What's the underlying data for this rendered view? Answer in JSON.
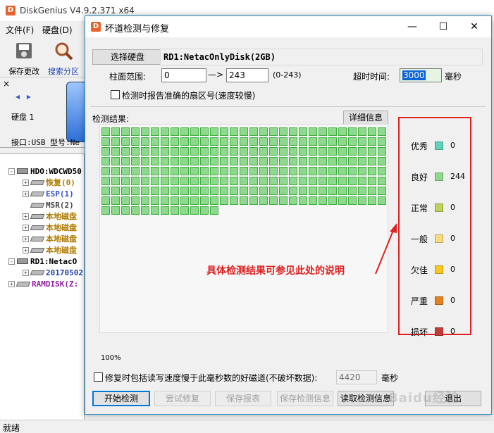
{
  "app": {
    "title": "DiskGenius V4.9.2.371 x64",
    "logo_letter": "D",
    "menu": [
      "文件(F)",
      "硬盘(D)"
    ],
    "toolbar": [
      {
        "label": "保存更改",
        "icon": "save-disk-icon"
      },
      {
        "label": "搜索分区",
        "icon": "magnifier-icon"
      }
    ],
    "disk_nav": "◂ ▸",
    "disk_label": "硬盘 1",
    "disk_interface": "接口:USB  型号:Ne",
    "tree": [
      {
        "label": "HDO:WDCWD50",
        "color": "#000000",
        "level": 0,
        "kind": "disk",
        "expander": "-"
      },
      {
        "label": "恢复(0)",
        "color": "#b07a00",
        "level": 1,
        "kind": "part",
        "expander": "+"
      },
      {
        "label": "ESP(1)",
        "color": "#3050d0",
        "level": 1,
        "kind": "part",
        "expander": "+"
      },
      {
        "label": "MSR(2)",
        "color": "#444444",
        "level": 1,
        "kind": "part",
        "expander": ""
      },
      {
        "label": "本地磁盘",
        "color": "#b07a00",
        "level": 1,
        "kind": "part",
        "expander": "+"
      },
      {
        "label": "本地磁盘",
        "color": "#b07a00",
        "level": 1,
        "kind": "part",
        "expander": "+"
      },
      {
        "label": "本地磁盘",
        "color": "#b07a00",
        "level": 1,
        "kind": "part",
        "expander": "+"
      },
      {
        "label": "本地磁盘",
        "color": "#b07a00",
        "level": 1,
        "kind": "part",
        "expander": "+"
      },
      {
        "label": "RD1:NetacO",
        "color": "#000000",
        "level": 0,
        "kind": "disk",
        "expander": "-"
      },
      {
        "label": "20170502",
        "color": "#2040b0",
        "level": 1,
        "kind": "part",
        "expander": "+"
      },
      {
        "label": "RAMDISK(Z:",
        "color": "#9020a0",
        "level": 0,
        "kind": "part",
        "expander": "+"
      }
    ],
    "status": "就绪"
  },
  "dialog": {
    "title": "坏道检测与修复",
    "logo_letter": "D",
    "select_disk_button": "选择硬盘",
    "disk_name": "RD1:NetacOnlyDisk(2GB)",
    "cylinder_label": "柱面范围:",
    "cylinder_from": "0",
    "arrow_text": "—>",
    "cylinder_to": "243",
    "cylinder_hint": "(0-243)",
    "timeout_label": "超时时间:",
    "timeout_value": "3000",
    "timeout_unit": "毫秒",
    "report_sector_checkbox": "检测时报告准确的扇区号(速度较慢)",
    "result_label": "检测结果:",
    "detail_button": "详细信息",
    "percent": "100%",
    "repair_checkbox": "修复时包括读写速度慢于此毫秒数的好磁道(不破坏数据):",
    "repair_ms_value": "4420",
    "repair_ms_unit": "毫秒",
    "buttons": {
      "start": "开始检测",
      "try_repair": "尝试修复",
      "save_report": "保存报表",
      "save_info": "保存检测信息",
      "load_info": "读取检测信息",
      "exit": "退出"
    }
  },
  "legend": [
    {
      "name": "优秀",
      "count": "0",
      "color": "#5fd3b8"
    },
    {
      "name": "良好",
      "count": "244",
      "color": "#8fd98f"
    },
    {
      "name": "正常",
      "count": "0",
      "color": "#bcd35a"
    },
    {
      "name": "一般",
      "count": "0",
      "color": "#f6dc7a"
    },
    {
      "name": "欠佳",
      "count": "0",
      "color": "#f8c81e"
    },
    {
      "name": "严重",
      "count": "0",
      "color": "#e4831e"
    },
    {
      "name": "损坏",
      "count": "0",
      "color": "#c23c3c"
    }
  ],
  "scan": {
    "total_cells": 244,
    "cell_color": "#8fd98f",
    "cell_border": "#3fae3f"
  },
  "annotation": "具体检测结果可参见此处的说明",
  "watermark": "Baidu经验"
}
